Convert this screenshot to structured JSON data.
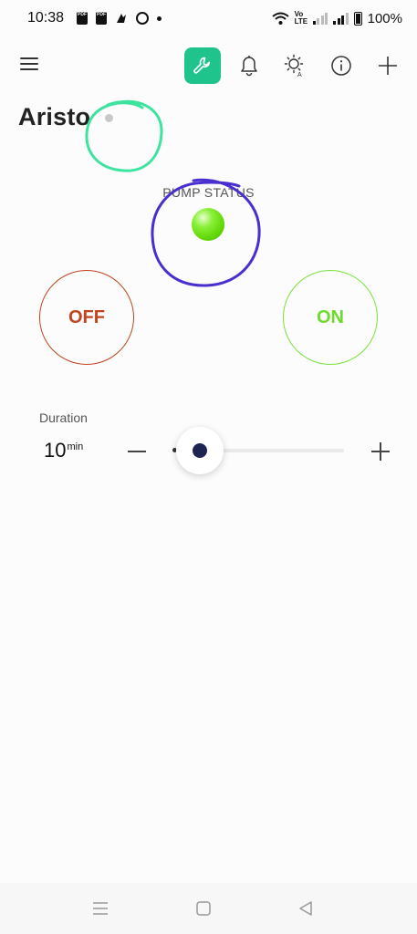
{
  "status_bar": {
    "time": "10:38",
    "battery_percent": "100%",
    "volte_label": "Vo LTE",
    "pdf_label": "PDF"
  },
  "toolbar": {
    "menu_icon": "hamburger-menu-icon",
    "wrench_icon": "wrench-icon",
    "bell_icon": "bell-icon",
    "sun_icon": "brightness-auto-icon",
    "info_icon": "info-icon",
    "add_icon": "plus-icon",
    "accent_color": "#1fc38c"
  },
  "page": {
    "title": "Aristo"
  },
  "pump": {
    "status_label": "PUMP STATUS",
    "status_color": "#5ed400",
    "off_label": "OFF",
    "on_label": "ON",
    "off_color": "#c2441e",
    "on_color": "#6cdc2c"
  },
  "duration": {
    "label": "Duration",
    "value": "10",
    "unit": "min",
    "slider_fraction": 0.0
  },
  "nav_bar": {
    "menu_icon": "recent-apps-icon",
    "home_icon": "home-icon",
    "back_icon": "back-icon"
  }
}
